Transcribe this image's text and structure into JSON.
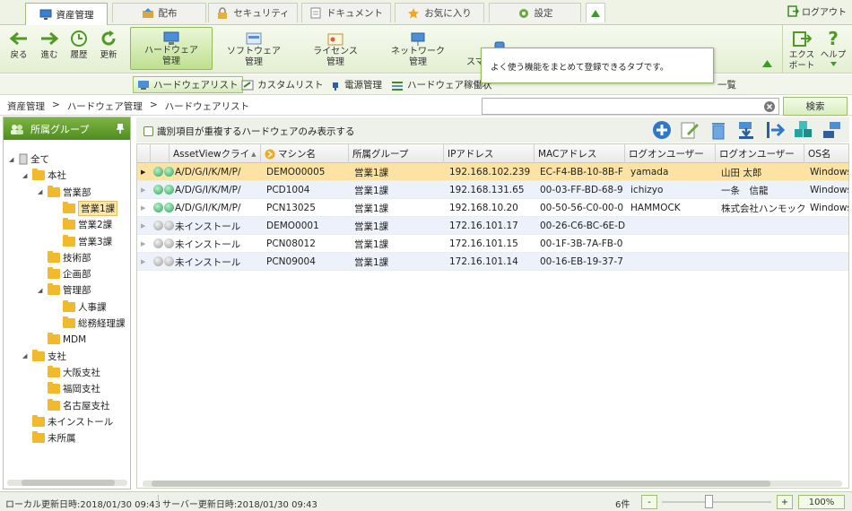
{
  "top_tabs": [
    {
      "label": "資産管理",
      "icon": "monitor-icon",
      "active": true
    },
    {
      "label": "配布",
      "icon": "distribution-icon"
    },
    {
      "label": "セキュリティ",
      "icon": "lock-icon"
    },
    {
      "label": "ドキュメント",
      "icon": "document-icon"
    },
    {
      "label": "お気に入り",
      "icon": "star-icon"
    },
    {
      "label": "設定",
      "icon": "gear-icon"
    }
  ],
  "logout_label": "ログアウト",
  "nav": {
    "back": "戻る",
    "forward": "進む",
    "history": "履歴",
    "refresh": "更新"
  },
  "ribbon_items": [
    {
      "label": "ハードウェア\n管理",
      "active": true
    },
    {
      "label": "ソフトウェア\n管理"
    },
    {
      "label": "ライセンス\n管理"
    },
    {
      "label": "ネットワーク\n管理"
    },
    {
      "label": "スマ"
    },
    {
      "label": ""
    }
  ],
  "export_label": "エクス\nポート",
  "help_label": "ヘルプ",
  "tooltip": "よく使う機能をまとめて登録できるタブです。",
  "sub_items": [
    {
      "label": "ハードウェアリスト",
      "active": true
    },
    {
      "label": "カスタムリスト"
    },
    {
      "label": "電源管理"
    },
    {
      "label": "ハードウェア稼働状"
    },
    {
      "label": "一覧"
    }
  ],
  "breadcrumb": [
    "資産管理",
    ">",
    "ハードウェア管理",
    ">",
    "ハードウェアリスト"
  ],
  "search_button": "検索",
  "search_value": "",
  "left_panel_title": "所属グループ",
  "tree": [
    {
      "label": "全て",
      "level": 0,
      "type": "pc",
      "toggle": "◢"
    },
    {
      "label": "本社",
      "level": 1,
      "type": "folder",
      "toggle": "◢"
    },
    {
      "label": "営業部",
      "level": 2,
      "type": "folder",
      "toggle": "◢"
    },
    {
      "label": "営業1課",
      "level": 3,
      "type": "folder",
      "selected": true
    },
    {
      "label": "営業2課",
      "level": 3,
      "type": "folder"
    },
    {
      "label": "営業3課",
      "level": 3,
      "type": "folder"
    },
    {
      "label": "技術部",
      "level": 2,
      "type": "folder"
    },
    {
      "label": "企画部",
      "level": 2,
      "type": "folder"
    },
    {
      "label": "管理部",
      "level": 2,
      "type": "folder",
      "toggle": "◢"
    },
    {
      "label": "人事課",
      "level": 3,
      "type": "folder"
    },
    {
      "label": "総務経理課",
      "level": 3,
      "type": "folder"
    },
    {
      "label": "MDM",
      "level": 2,
      "type": "folder"
    },
    {
      "label": "支社",
      "level": 1,
      "type": "folder",
      "toggle": "◢"
    },
    {
      "label": "大阪支社",
      "level": 2,
      "type": "folder"
    },
    {
      "label": "福岡支社",
      "level": 2,
      "type": "folder"
    },
    {
      "label": "名古屋支社",
      "level": 2,
      "type": "folder"
    },
    {
      "label": "未インストール",
      "level": 1,
      "type": "folder"
    },
    {
      "label": "未所属",
      "level": 1,
      "type": "folder"
    }
  ],
  "checkbox_label": "識別項目が重複するハードウェアのみ表示する",
  "columns": [
    "AssetViewクライ",
    "マシン名",
    "所属グループ",
    "IPアドレス",
    "MACアドレス",
    "ログオンユーザー",
    "ログオンユーザー",
    "OS名"
  ],
  "rows": [
    {
      "status": "online",
      "client": "A/D/G/I/K/M/P/",
      "machine": "DEMO00005",
      "group": "営業1課",
      "ip": "192.168.102.239",
      "mac": "EC-F4-BB-10-8B-F",
      "user": "yamada",
      "username": "山田 太郎",
      "os": "Windows",
      "selected": true
    },
    {
      "status": "online",
      "client": "A/D/G/I/K/M/P/",
      "machine": "PCD1004",
      "group": "営業1課",
      "ip": "192.168.131.65",
      "mac": "00-03-FF-BD-68-9",
      "user": "ichizyo",
      "username": "一条　信龍",
      "os": "Windows"
    },
    {
      "status": "online",
      "client": "A/D/G/I/K/M/P/",
      "machine": "PCN13025",
      "group": "営業1課",
      "ip": "192.168.10.20",
      "mac": "00-50-56-C0-00-0",
      "user": "HAMMOCK",
      "username": "株式会社ハンモック",
      "os": "Windows"
    },
    {
      "status": "offline",
      "client": "未インストール",
      "machine": "DEMO0001",
      "group": "営業1課",
      "ip": "172.16.101.17",
      "mac": "00-26-C6-BC-6E-D",
      "user": "",
      "username": "",
      "os": ""
    },
    {
      "status": "offline",
      "client": "未インストール",
      "machine": "PCN08012",
      "group": "営業1課",
      "ip": "172.16.101.15",
      "mac": "00-1F-3B-7A-FB-0",
      "user": "",
      "username": "",
      "os": ""
    },
    {
      "status": "offline",
      "client": "未インストール",
      "machine": "PCN09004",
      "group": "営業1課",
      "ip": "172.16.101.14",
      "mac": "00-16-EB-19-37-7",
      "user": "",
      "username": "",
      "os": ""
    }
  ],
  "status": {
    "local": "ローカル更新日時:2018/01/30 09:43",
    "server": "サーバー更新日時:2018/01/30 09:43",
    "count": "6件",
    "zoom": "100%",
    "minus": "-",
    "plus": "+"
  },
  "colors": {
    "accent": "#5d9a2a",
    "selected_row": "#fde3a3",
    "alt_row": "#edf2fa"
  }
}
